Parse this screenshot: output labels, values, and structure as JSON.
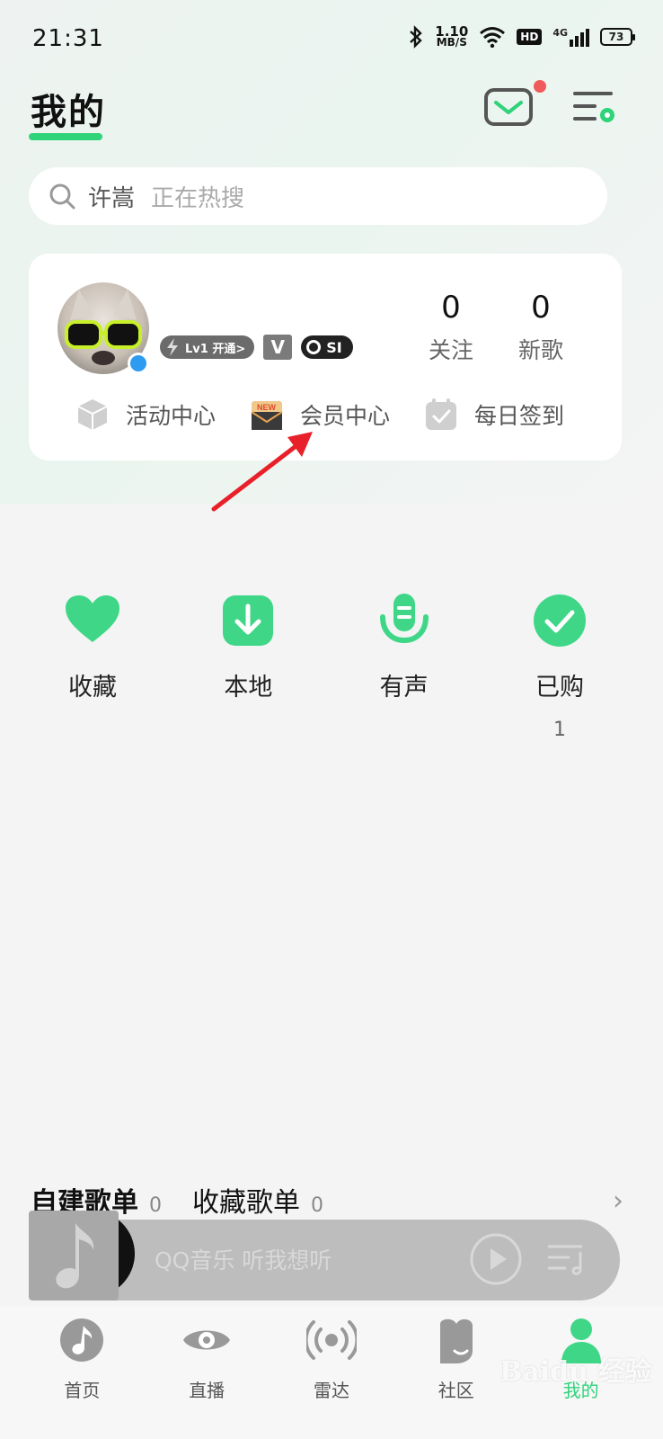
{
  "status_bar": {
    "time": "21:31",
    "speed_value": "1.10",
    "speed_unit": "MB/S",
    "hd": "HD",
    "network": "4G",
    "battery": "73"
  },
  "header": {
    "title": "我的"
  },
  "search": {
    "term": "许嵩",
    "hint": "正在热搜"
  },
  "profile": {
    "level_badge": "Lv1 开通>",
    "v_badge": "V",
    "s_badge": "SI",
    "stats": [
      {
        "value": "0",
        "label": "关注"
      },
      {
        "value": "0",
        "label": "新歌"
      }
    ],
    "quick_links": [
      {
        "label": "活动中心",
        "icon": "cube-icon"
      },
      {
        "label": "会员中心",
        "icon": "vip-envelope-icon"
      },
      {
        "label": "每日签到",
        "icon": "calendar-check-icon"
      }
    ]
  },
  "features": [
    {
      "label": "收藏",
      "count": "",
      "icon": "heart-icon"
    },
    {
      "label": "本地",
      "count": "",
      "icon": "download-icon"
    },
    {
      "label": "有声",
      "count": "",
      "icon": "microphone-icon"
    },
    {
      "label": "已购",
      "count": "1",
      "icon": "check-icon"
    }
  ],
  "playlists": {
    "created_title": "自建歌单",
    "created_count": "0",
    "collected_title": "收藏歌单",
    "collected_count": "0"
  },
  "player": {
    "text": "QQ音乐 听我想听"
  },
  "tabs": [
    {
      "label": "首页",
      "icon": "music-note-icon"
    },
    {
      "label": "直播",
      "icon": "eye-icon"
    },
    {
      "label": "雷达",
      "icon": "radar-icon"
    },
    {
      "label": "社区",
      "icon": "community-icon"
    },
    {
      "label": "我的",
      "icon": "profile-icon",
      "active": true
    }
  ],
  "watermark": "Baidu 经验",
  "colors": {
    "accent": "#2fd37a",
    "notification_dot": "#f05a5a",
    "annotation_arrow": "#e8202a"
  }
}
